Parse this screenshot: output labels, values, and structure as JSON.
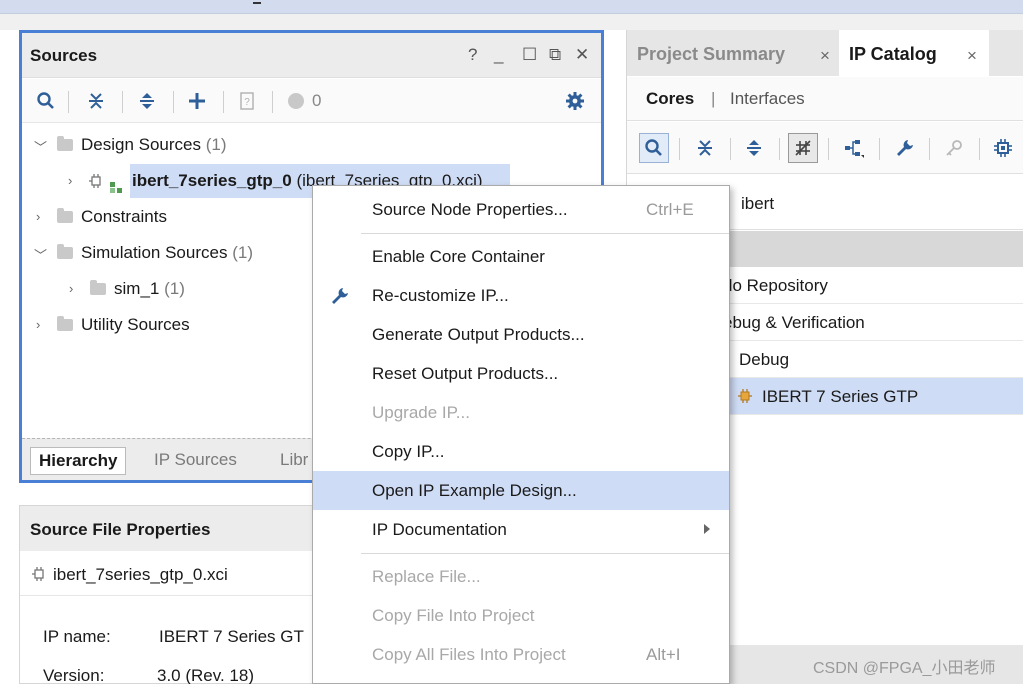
{
  "sources_panel": {
    "title": "Sources",
    "controls": [
      "?",
      "_",
      "☐",
      "⧉",
      "✕"
    ],
    "toolbar": {
      "status_count": "0"
    },
    "tree": {
      "design_sources": {
        "label": "Design Sources",
        "count": "(1)"
      },
      "ip_item": {
        "name": "ibert_7series_gtp_0",
        "file": "(ibert_7series_gtp_0.xci)"
      },
      "constraints": {
        "label": "Constraints"
      },
      "simulation_sources": {
        "label": "Simulation Sources",
        "count": "(1)"
      },
      "sim_1": {
        "label": "sim_1",
        "count": "(1)"
      },
      "utility_sources": {
        "label": "Utility Sources"
      }
    },
    "tabs": [
      "Hierarchy",
      "IP Sources",
      "Libr"
    ]
  },
  "source_file_properties": {
    "title": "Source File Properties",
    "file": "ibert_7series_gtp_0.xci",
    "rows": [
      {
        "key": "IP name:",
        "value": "IBERT 7 Series GT"
      },
      {
        "key": "Version:",
        "value": "3.0 (Rev. 18)"
      }
    ]
  },
  "right_panel": {
    "tabs": [
      {
        "label": "Project Summary",
        "close": "×"
      },
      {
        "label": "IP Catalog",
        "close": "×"
      }
    ],
    "view_tabs": {
      "cores": "Cores",
      "separator": "|",
      "interfaces": "Interfaces"
    },
    "search_value": "ibert",
    "rows": [
      {
        "label": "do Repository"
      },
      {
        "label": "ebug & Verification"
      },
      {
        "label": "Debug"
      },
      {
        "label": "IBERT 7 Series GTP"
      }
    ]
  },
  "context_menu": {
    "items": [
      {
        "label": "Source Node Properties...",
        "shortcut": "Ctrl+E"
      },
      {
        "label": "Enable Core Container"
      },
      {
        "label": "Re-customize IP..."
      },
      {
        "label": "Generate Output Products..."
      },
      {
        "label": "Reset Output Products..."
      },
      {
        "label": "Upgrade IP..."
      },
      {
        "label": "Copy IP..."
      },
      {
        "label": "Open IP Example Design..."
      },
      {
        "label": "IP Documentation"
      },
      {
        "label": "Replace File..."
      },
      {
        "label": "Copy File Into Project"
      },
      {
        "label": "Copy All Files Into Project",
        "shortcut": "Alt+I"
      }
    ]
  },
  "watermark": "CSDN @FPGA_小田老师",
  "colors": {
    "accent_border": "#4a7fd6",
    "selection": "#cfdcf5",
    "icon_blue": "#2f5f98"
  }
}
